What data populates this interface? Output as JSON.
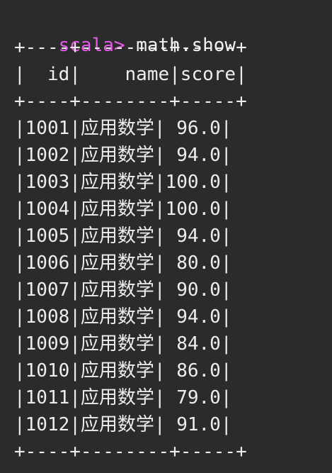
{
  "terminal": {
    "prompt": "scala>",
    "command": " math.show",
    "border": "+----+--------+-----+",
    "header": "|  id|    name|score|",
    "rows": [
      "|1001|应用数学| 96.0|",
      "|1002|应用数学| 94.0|",
      "|1003|应用数学|100.0|",
      "|1004|应用数学|100.0|",
      "|1005|应用数学| 94.0|",
      "|1006|应用数学| 80.0|",
      "|1007|应用数学| 90.0|",
      "|1008|应用数学| 94.0|",
      "|1009|应用数学| 84.0|",
      "|1010|应用数学| 86.0|",
      "|1011|应用数学| 79.0|",
      "|1012|应用数学| 91.0|"
    ]
  },
  "colors": {
    "background": "#2b2b2b",
    "prompt": "#e85ae8",
    "text": "#ededed"
  }
}
